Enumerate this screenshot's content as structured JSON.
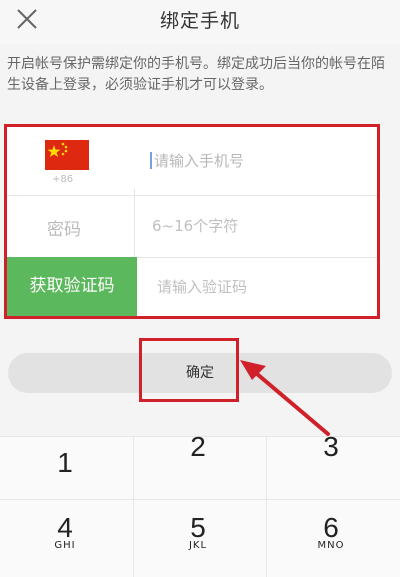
{
  "nav": {
    "title": "绑定手机",
    "close_icon": "close-icon"
  },
  "hint": "开启帐号保护需绑定你的手机号。绑定成功后当你的帐号在陌生设备上登录，必须验证手机才可以登录。",
  "form": {
    "country_code": "+86",
    "phone_placeholder": "请输入手机号",
    "password_label": "密码",
    "password_placeholder": "6~16个字符",
    "get_code_label": "获取验证码",
    "code_placeholder": "请输入验证码"
  },
  "confirm_label": "确定",
  "keypad": {
    "keys": [
      {
        "num": "1",
        "letters": ""
      },
      {
        "num": "2",
        "letters": ""
      },
      {
        "num": "3",
        "letters": ""
      },
      {
        "num": "4",
        "letters": "GHI"
      },
      {
        "num": "5",
        "letters": "JKL"
      },
      {
        "num": "6",
        "letters": "MNO"
      }
    ]
  },
  "colors": {
    "annotation": "#d0202a",
    "get_code_bg": "#5cb85c",
    "confirm_bg": "#e2e2e2"
  }
}
